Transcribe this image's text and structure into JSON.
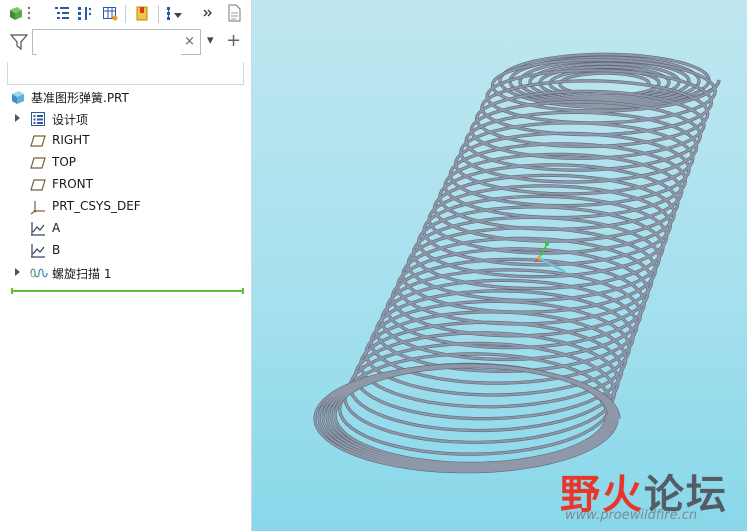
{
  "toolbar": {
    "icons": [
      "part-cube-icon",
      "more-vertical-icon",
      "tree-list-icon",
      "tree-columns-icon",
      "table-icon",
      "bookmark-icon",
      "tree-filter-icon",
      "more-chevron-icon",
      "document-icon"
    ]
  },
  "filter": {
    "search_value": "",
    "clear_label": "×",
    "dropdown_label": "▾",
    "add_label": "+"
  },
  "tree": {
    "root": "基准图形弹簧.PRT",
    "items": [
      {
        "label": "设计项",
        "icon": "design-items-icon",
        "expandable": true
      },
      {
        "label": "RIGHT",
        "icon": "datum-plane-icon",
        "expandable": false
      },
      {
        "label": "TOP",
        "icon": "datum-plane-icon",
        "expandable": false
      },
      {
        "label": "FRONT",
        "icon": "datum-plane-icon",
        "expandable": false
      },
      {
        "label": "PRT_CSYS_DEF",
        "icon": "csys-icon",
        "expandable": false
      },
      {
        "label": "A",
        "icon": "datum-graph-icon",
        "expandable": false
      },
      {
        "label": "B",
        "icon": "datum-graph-icon",
        "expandable": false
      },
      {
        "label": "螺旋扫描 1",
        "icon": "helical-sweep-icon",
        "expandable": true
      }
    ]
  },
  "watermark": {
    "title_part1": "野火",
    "title_part2": "论坛",
    "url": "www.proewildfire.cn"
  },
  "colors": {
    "viewport_top": "#bfe7f0",
    "viewport_bottom": "#88d8ea",
    "spring": "#8e98a8",
    "insert_line": "#5fbf3a",
    "watermark_red": "#e8372a",
    "watermark_gray": "#555c66"
  }
}
